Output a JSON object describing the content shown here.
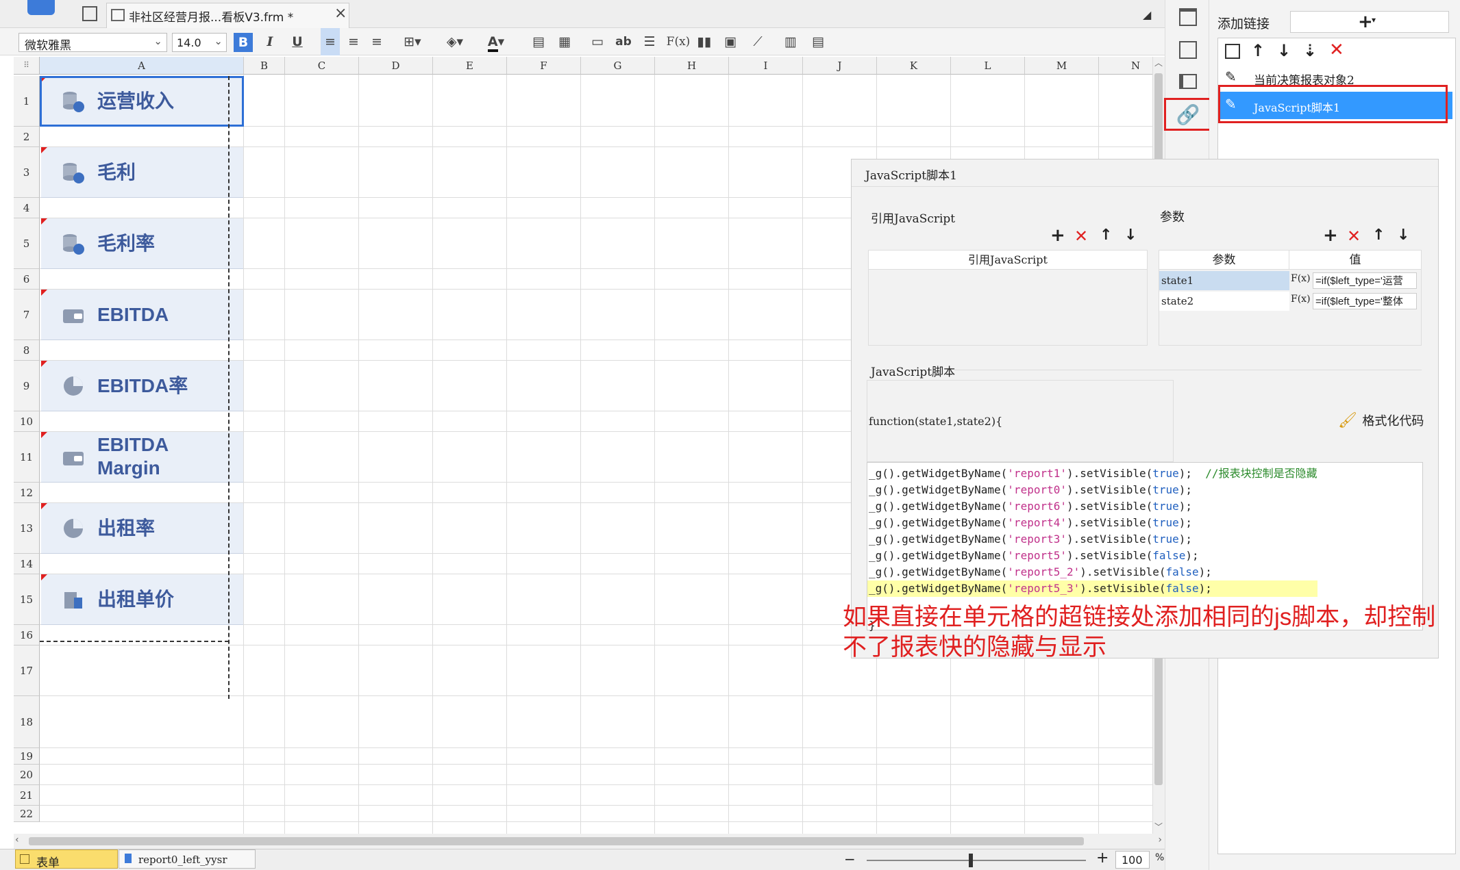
{
  "tabbar": {
    "file_tab": "非社区经营月报...看板V3.frm *",
    "close": "×"
  },
  "format": {
    "font_name": "微软雅黑",
    "font_size": "14.0",
    "bold": "B",
    "italic": "I",
    "underline": "U",
    "text_tool": "ab",
    "formula_tool": "F(x)",
    "font_color": "A"
  },
  "columns": [
    "A",
    "B",
    "C",
    "D",
    "E",
    "F",
    "G",
    "H",
    "I",
    "J",
    "K",
    "L",
    "M",
    "N"
  ],
  "rows": [
    "1",
    "2",
    "3",
    "4",
    "5",
    "6",
    "7",
    "8",
    "9",
    "10",
    "11",
    "12",
    "13",
    "14",
    "15",
    "16",
    "17",
    "18",
    "19",
    "20",
    "21",
    "22"
  ],
  "cards": [
    {
      "label": "运营收入",
      "icon": "database-coin-icon"
    },
    {
      "label": "毛利",
      "icon": "database-coin-icon"
    },
    {
      "label": "毛利率",
      "icon": "database-coin-icon"
    },
    {
      "label": "EBITDA",
      "icon": "wallet-icon"
    },
    {
      "label": "EBITDA率",
      "icon": "pie-chart-icon"
    },
    {
      "label": "EBITDA Margin",
      "line1": "EBITDA",
      "line2": "Margin",
      "icon": "wallet-icon"
    },
    {
      "label": "出租率",
      "icon": "pie-chart-icon"
    },
    {
      "label": "出租单价",
      "icon": "building-icon"
    }
  ],
  "sheet_tabs": {
    "form": "表单",
    "report": "report0_left_yysr"
  },
  "zoom": {
    "minus": "−",
    "plus": "+",
    "value": "100",
    "unit": "%"
  },
  "right_panel": {
    "title": "添加链接",
    "add": "+",
    "items": [
      {
        "label": "当前决策报表对象2",
        "selected": false
      },
      {
        "label": "JavaScript脚本1",
        "selected": true
      }
    ]
  },
  "dialog": {
    "title": "JavaScript脚本1",
    "ref_js_label": "引用JavaScript",
    "ref_js_header": "引用JavaScript",
    "params_label": "参数",
    "params_col_param": "参数",
    "params_col_value": "值",
    "params": [
      {
        "name": "state1",
        "fx": "F(x)",
        "value": "=if($left_type='运营"
      },
      {
        "name": "state2",
        "fx": "F(x)",
        "value": "=if($left_type='整体"
      }
    ],
    "script_label": "JavaScript脚本",
    "func_sig": "function(state1,state2){",
    "format_code": "格式化代码",
    "code_lines": [
      {
        "pre": "_g().getWidgetByName(",
        "str": "'report1'",
        "mid": ").setVisible(",
        "kw": "true",
        "post": ");",
        "comment": "  //报表块控制是否隐藏"
      },
      {
        "pre": "_g().getWidgetByName(",
        "str": "'report0'",
        "mid": ").setVisible(",
        "kw": "true",
        "post": ");",
        "comment": ""
      },
      {
        "pre": "_g().getWidgetByName(",
        "str": "'report6'",
        "mid": ").setVisible(",
        "kw": "true",
        "post": ");",
        "comment": ""
      },
      {
        "pre": "_g().getWidgetByName(",
        "str": "'report4'",
        "mid": ").setVisible(",
        "kw": "true",
        "post": ");",
        "comment": ""
      },
      {
        "pre": "_g().getWidgetByName(",
        "str": "'report3'",
        "mid": ").setVisible(",
        "kw": "true",
        "post": ");",
        "comment": ""
      },
      {
        "pre": "_g().getWidgetByName(",
        "str": "'report5'",
        "mid": ").setVisible(",
        "kw": "false",
        "post": ");",
        "comment": ""
      },
      {
        "pre": "_g().getWidgetByName(",
        "str": "'report5_2'",
        "mid": ").setVisible(",
        "kw": "false",
        "post": ");",
        "comment": ""
      },
      {
        "pre": "_g().getWidgetByName(",
        "str": "'report5_3'",
        "mid": ").setVisible(",
        "kw": "false",
        "post": ");",
        "comment": ""
      }
    ],
    "closing": "}"
  },
  "annotation": {
    "line1": "如果直接在单元格的超链接处添加相同的js脚本，却控制",
    "line2": "不了报表快的隐藏与显示"
  },
  "colors": {
    "accent": "#3399ff",
    "card_text": "#3d5a9c",
    "annotation": "#e02020"
  }
}
